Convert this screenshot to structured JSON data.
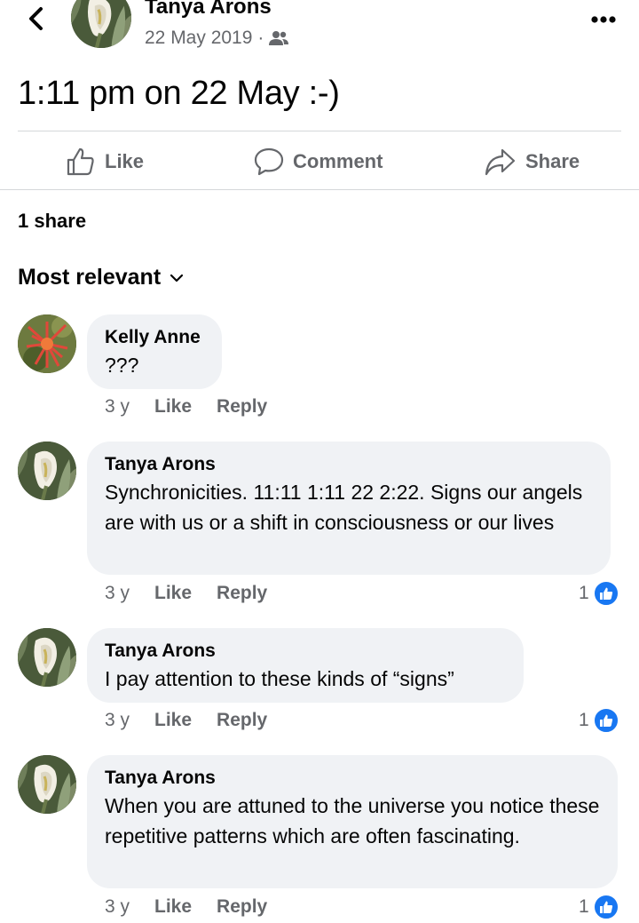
{
  "header": {
    "author": "Tanya Arons",
    "date": "22 May 2019",
    "separator": "·",
    "audience_icon": "friends-icon"
  },
  "post": {
    "text": "1:11 pm on 22 May :-)"
  },
  "actions": {
    "like": "Like",
    "comment": "Comment",
    "share": "Share"
  },
  "shares_count": "1 share",
  "sort_label": "Most relevant",
  "colors": {
    "accent": "#1877f2",
    "bubble": "#f0f2f5",
    "secondary_text": "#65676b"
  },
  "comments": [
    {
      "author": "Kelly Anne",
      "text": "???",
      "time": "3 y",
      "like": "Like",
      "reply": "Reply"
    },
    {
      "author": "Tanya Arons",
      "text": "Synchronicities. 11:11 1:11 22 2:22. Signs our angels are with us or a shift in consciousness or our lives",
      "time": "3 y",
      "like": "Like",
      "reply": "Reply",
      "reactions": "1"
    },
    {
      "author": "Tanya Arons",
      "text": "I pay attention to these kinds of “signs”",
      "time": "3 y",
      "like": "Like",
      "reply": "Reply",
      "reactions": "1"
    },
    {
      "author": "Tanya Arons",
      "text": "When you are attuned to the universe you notice these repetitive patterns which are often fascinating.",
      "time": "3 y",
      "like": "Like",
      "reply": "Reply",
      "reactions": "1"
    }
  ]
}
